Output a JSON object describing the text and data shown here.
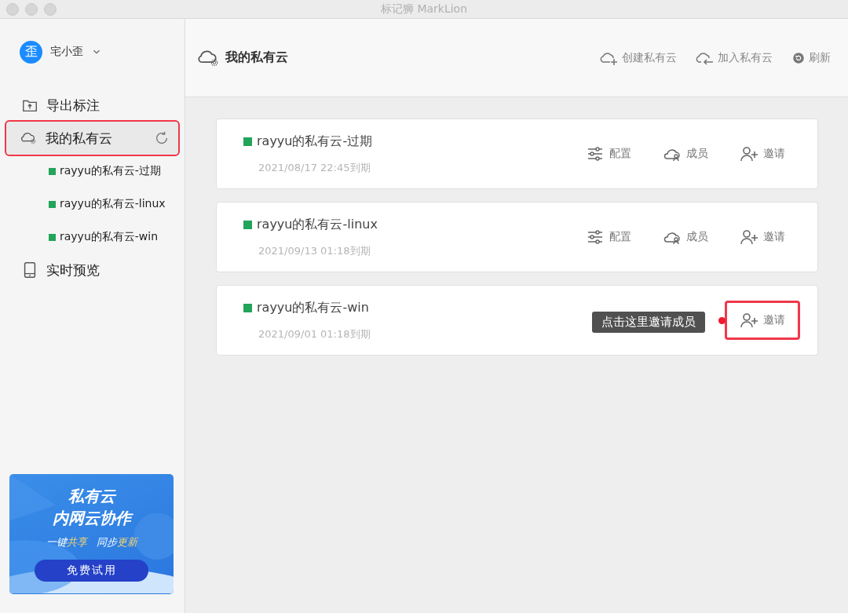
{
  "window": {
    "title": "标记狮 MarkLion"
  },
  "sidebar": {
    "user": {
      "avatar": "歪",
      "name": "宅小歪"
    },
    "items": [
      {
        "kind": "export",
        "label": "导出标注",
        "selected": false,
        "highlighted": false
      },
      {
        "kind": "cloud",
        "label": "我的私有云",
        "selected": true,
        "highlighted": true,
        "children": [
          {
            "label": "rayyu的私有云-过期",
            "color": "#22a45a"
          },
          {
            "label": "rayyu的私有云-linux",
            "color": "#22a45a"
          },
          {
            "label": "rayyu的私有云-win",
            "color": "#22a45a"
          }
        ]
      },
      {
        "kind": "preview",
        "label": "实时预览",
        "selected": false,
        "highlighted": false
      }
    ],
    "banner": {
      "title_lines": [
        "私有云",
        "内网云协作"
      ],
      "tagline": [
        {
          "text": "一键",
          "accent": false
        },
        {
          "text": "共享",
          "accent": true
        },
        {
          "text": "同步",
          "accent": false
        },
        {
          "text": "更新",
          "accent": true
        }
      ],
      "button": "免费试用"
    }
  },
  "header": {
    "title": "我的私有云",
    "actions": [
      {
        "kind": "create",
        "label": "创建私有云"
      },
      {
        "kind": "join",
        "label": "加入私有云"
      },
      {
        "kind": "refresh",
        "label": "刷新"
      }
    ]
  },
  "clouds": [
    {
      "name": "rayyu的私有云-过期",
      "color": "#22a45a",
      "expiry": "2021/08/17 22:45到期",
      "actions": [
        {
          "kind": "config",
          "label": "配置",
          "highlighted": false
        },
        {
          "kind": "members",
          "label": "成员",
          "highlighted": false
        },
        {
          "kind": "invite",
          "label": "邀请",
          "highlighted": false
        }
      ]
    },
    {
      "name": "rayyu的私有云-linux",
      "color": "#22a45a",
      "expiry": "2021/09/13 01:18到期",
      "actions": [
        {
          "kind": "config",
          "label": "配置",
          "highlighted": false
        },
        {
          "kind": "members",
          "label": "成员",
          "highlighted": false
        },
        {
          "kind": "invite",
          "label": "邀请",
          "highlighted": false
        }
      ]
    },
    {
      "name": "rayyu的私有云-win",
      "color": "#22a45a",
      "expiry": "2021/09/01 01:18到期",
      "tooltip": "点击这里邀请成员",
      "actions": [
        {
          "kind": "invite",
          "label": "邀请",
          "highlighted": true
        }
      ]
    }
  ]
}
